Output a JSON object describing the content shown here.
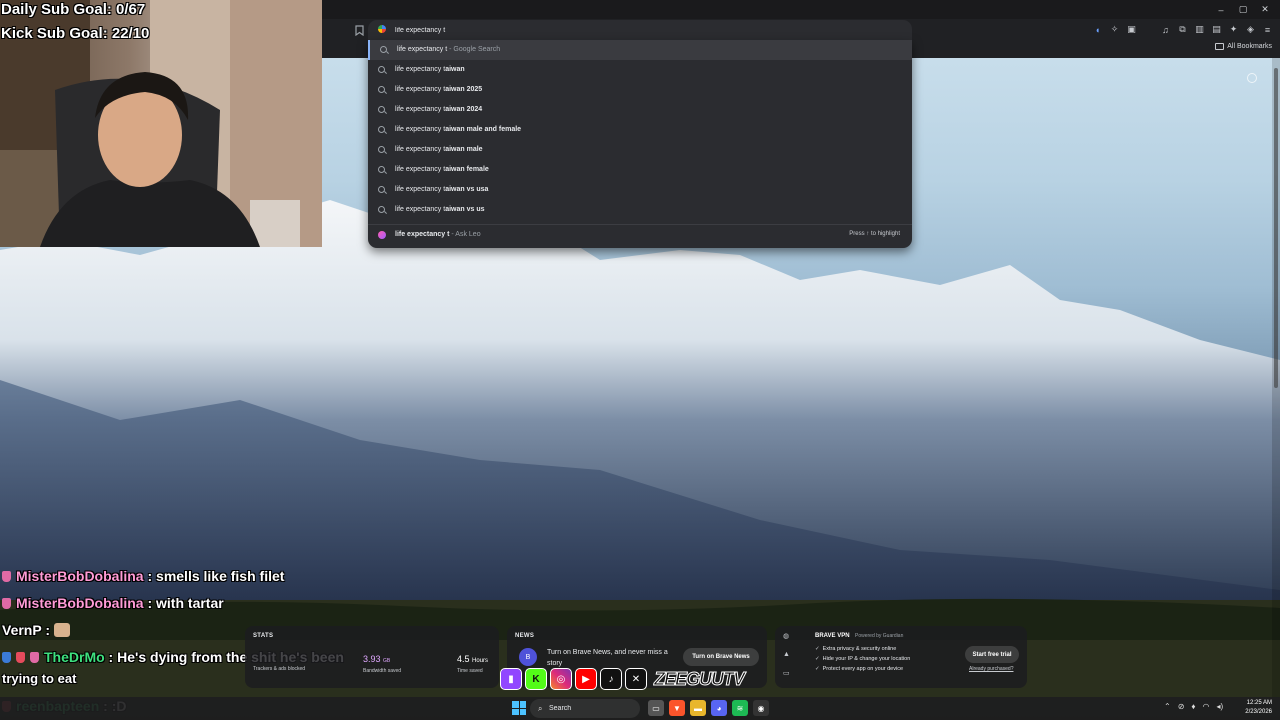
{
  "stream": {
    "daily_sub_goal": "Daily Sub Goal: 0/67",
    "kick_sub_goal": "Kick Sub Goal: 22/10"
  },
  "chat": [
    {
      "name": "MisterBobDobalina",
      "sep": " : ",
      "message": "smells like fish filet"
    },
    {
      "name": "MisterBobDobalina",
      "sep": " : ",
      "message": "with tartar"
    },
    {
      "name": "VernP",
      "sep": " : ",
      "message": ""
    },
    {
      "name": "TheDrMo",
      "sep": " : ",
      "message": "He's dying from the shit he's been"
    },
    {
      "name": "",
      "sep": "",
      "message": "trying to eat"
    },
    {
      "name": "reenbapteen",
      "sep": " : ",
      "message": ":D"
    }
  ],
  "browser": {
    "omnibox_value": "life expectancy t",
    "all_bookmarks": "All Bookmarks",
    "window": {
      "minimize": "–",
      "maximize": "▢",
      "close": "✕"
    }
  },
  "suggestions": [
    {
      "typed": "life expectancy t",
      "completion": "",
      "suffix": " - Google Search"
    },
    {
      "typed": "life expectancy t",
      "completion": "aiwan",
      "suffix": ""
    },
    {
      "typed": "life expectancy t",
      "completion": "aiwan 2025",
      "suffix": ""
    },
    {
      "typed": "life expectancy t",
      "completion": "aiwan 2024",
      "suffix": ""
    },
    {
      "typed": "life expectancy t",
      "completion": "aiwan male and female",
      "suffix": ""
    },
    {
      "typed": "life expectancy t",
      "completion": "aiwan male",
      "suffix": ""
    },
    {
      "typed": "life expectancy t",
      "completion": "aiwan female",
      "suffix": ""
    },
    {
      "typed": "life expectancy t",
      "completion": "aiwan vs usa",
      "suffix": ""
    },
    {
      "typed": "life expectancy t",
      "completion": "aiwan vs us",
      "suffix": ""
    }
  ],
  "ask_leo": {
    "query": "life expectancy t",
    "suffix": " - Ask Leo",
    "hint": "Press ↑ to highlight"
  },
  "stats_widget": {
    "label": "STATS",
    "trackers_label": "Trackers & ads blocked",
    "bandwidth_value": "3.93",
    "bandwidth_unit": "GB",
    "bandwidth_label": "Bandwidth saved",
    "time_value": "4.5",
    "time_unit": "Hours",
    "time_label": "Time saved"
  },
  "news_widget": {
    "label": "NEWS",
    "logo_letter": "B",
    "text": "Turn on Brave News, and never miss a story",
    "button": "Turn on Brave News"
  },
  "vpn_widget": {
    "title": "BRAVE VPN",
    "powered": "Powered by Guardian",
    "items": [
      "Extra privacy & security online",
      "Hide your IP & change your location",
      "Protect every app on your device"
    ],
    "button": "Start free trial",
    "already": "Already purchased?"
  },
  "socials": {
    "handle": "ZEEGUUTV"
  },
  "taskbar": {
    "search_placeholder": "Search",
    "time": "12:25 AM",
    "date": "2/23/2026"
  },
  "colors": {
    "accent_blue": "#8ab4f8",
    "chat_pink": "#ff9bd6",
    "chat_green": "#3ee07e",
    "windows_blue": "#4cc2ff"
  }
}
